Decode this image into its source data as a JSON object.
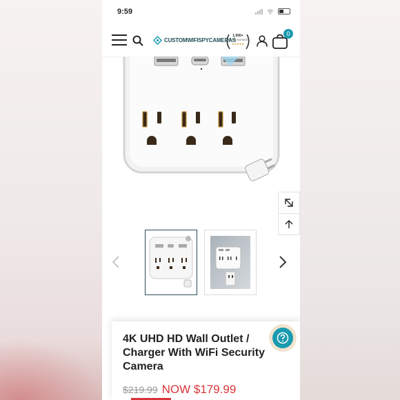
{
  "status_bar": {
    "time": "9:59"
  },
  "header": {
    "brand_name": "CUSTOMWIFISPYCAMERAS",
    "award": {
      "line1": "1,500+",
      "line2": "5-STAR RATINGS",
      "stars": "★★★★★"
    },
    "cart_count": "0"
  },
  "product": {
    "title": "4K UHD HD Wall Outlet / Charger With WiFi Security Camera",
    "price_old": "$219.99",
    "price_now": "NOW $179.99"
  },
  "colors": {
    "accent": "#1a9bb0",
    "sale": "#d9343a",
    "brand": "#1d4f57"
  },
  "icons": [
    "menu-icon",
    "search-icon",
    "account-icon",
    "cart-icon",
    "expand-icon",
    "arrow-up-icon",
    "chevron-left-icon",
    "chevron-right-icon",
    "help-icon"
  ]
}
